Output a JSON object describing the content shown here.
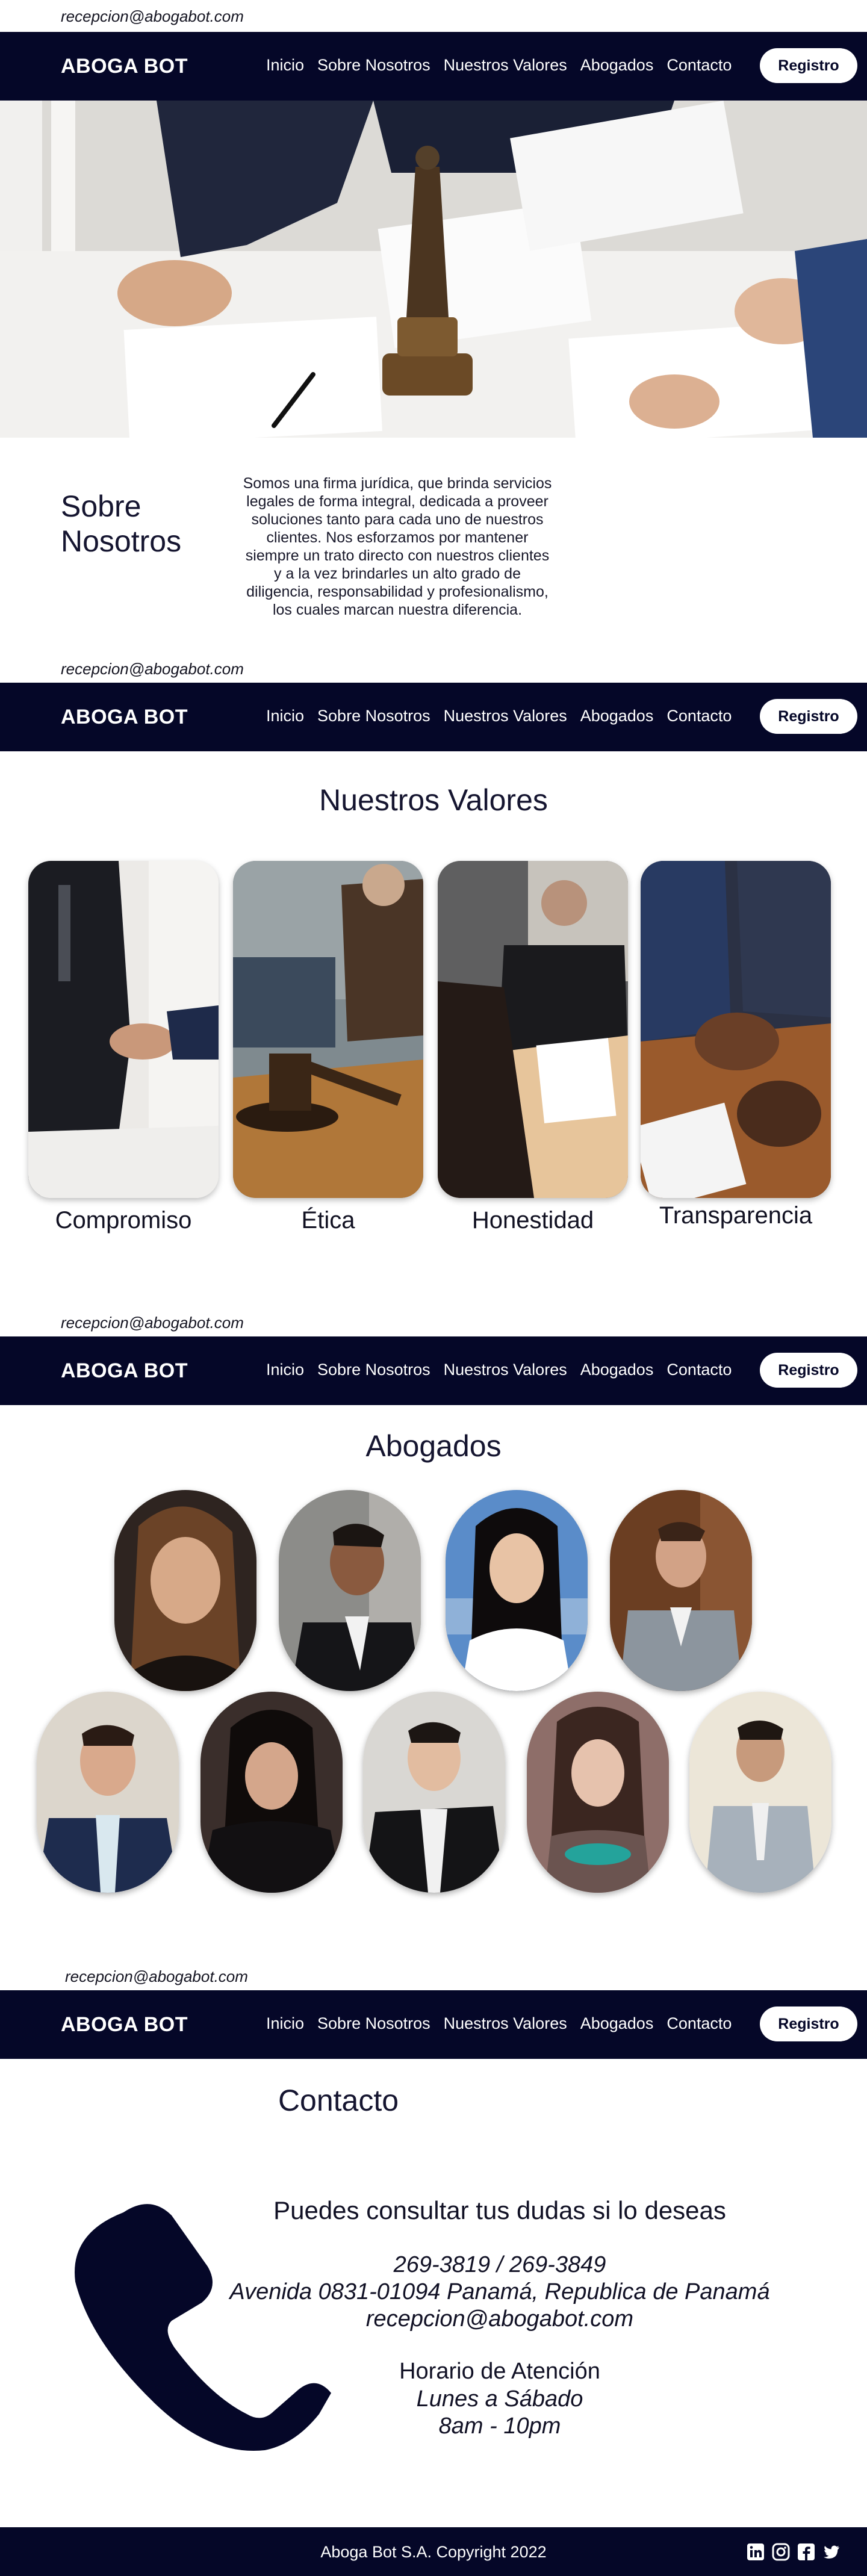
{
  "email": "recepcion@abogabot.com",
  "brand": "ABOGA BOT",
  "nav": [
    "Inicio",
    "Sobre Nosotros",
    "Nuestros Valores",
    "Abogados",
    "Contacto"
  ],
  "register_label": "Registro",
  "sobre": {
    "title": "Sobre Nosotros",
    "text": "Somos una firma jurídica, que brinda servicios legales de forma integral, dedicada a proveer soluciones tanto para cada uno de nuestros clientes. Nos esforzamos por mantener siempre un trato directo con nuestros clientes y a la vez brindarles un alto grado de diligencia, responsabilidad y profesionalismo,  los cuales marcan nuestra diferencia."
  },
  "valores": {
    "title": "Nuestros Valores",
    "items": [
      "Compromiso",
      "Ética",
      "Honestidad",
      "Transparencia"
    ]
  },
  "abogados": {
    "title": "Abogados"
  },
  "contacto": {
    "title": "Contacto",
    "lead": "Puedes consultar tus dudas si lo deseas",
    "phones": "269-3819 / 269-3849",
    "address": "Avenida 0831-01094 Panamá, Republica de Panamá",
    "email": "recepcion@abogabot.com",
    "hours_title": "Horario de Atención",
    "days": "Lunes a Sábado",
    "time": "8am - 10pm"
  },
  "footer": {
    "copyright": "Aboga Bot S.A. Copyright 2022"
  },
  "colors": {
    "navy": "#050728",
    "white": "#ffffff"
  }
}
